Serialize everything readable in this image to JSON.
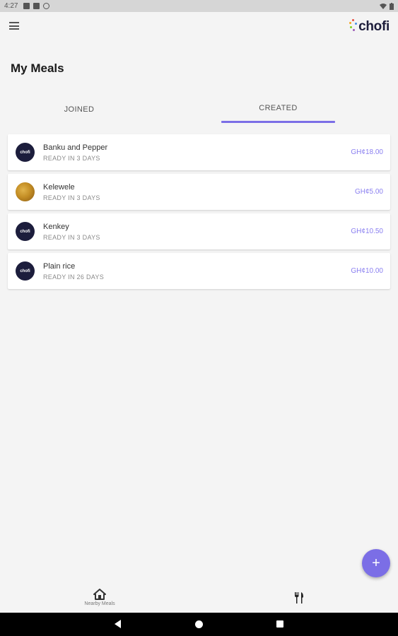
{
  "status_bar": {
    "time": "4:27"
  },
  "app_bar": {
    "logo_text": "chofi",
    "logo_dot_colors": [
      "#e94b3c",
      "#f5a623",
      "#4a90e2",
      "#7ed321",
      "#9b59b6"
    ]
  },
  "page": {
    "title": "My Meals"
  },
  "tabs": [
    {
      "label": "JOINED",
      "active": false
    },
    {
      "label": "CREATED",
      "active": true
    }
  ],
  "meals": [
    {
      "name": "Banku and Pepper",
      "ready": "READY IN 3 DAYS",
      "price": "GH¢18.00",
      "avatar": "chofi-logo",
      "avatar_text": "chofi"
    },
    {
      "name": "Kelewele",
      "ready": "READY IN 3 DAYS",
      "price": "GH¢5.00",
      "avatar": "food-photo"
    },
    {
      "name": "Kenkey",
      "ready": "READY IN 3 DAYS",
      "price": "GH¢10.50",
      "avatar": "chofi-logo",
      "avatar_text": "chofi"
    },
    {
      "name": "Plain rice",
      "ready": "READY IN 26 DAYS",
      "price": "GH¢10.00",
      "avatar": "chofi-logo",
      "avatar_text": "chofi"
    }
  ],
  "fab": {
    "icon": "plus-icon",
    "glyph": "+"
  },
  "bottom_nav": [
    {
      "label": "Nearby Meals",
      "icon": "home-icon"
    },
    {
      "label": "",
      "icon": "fork-knife-icon"
    }
  ],
  "colors": {
    "accent": "#7b6ee6",
    "price": "#8a7ff0",
    "logo_dark": "#1c1d3c"
  }
}
